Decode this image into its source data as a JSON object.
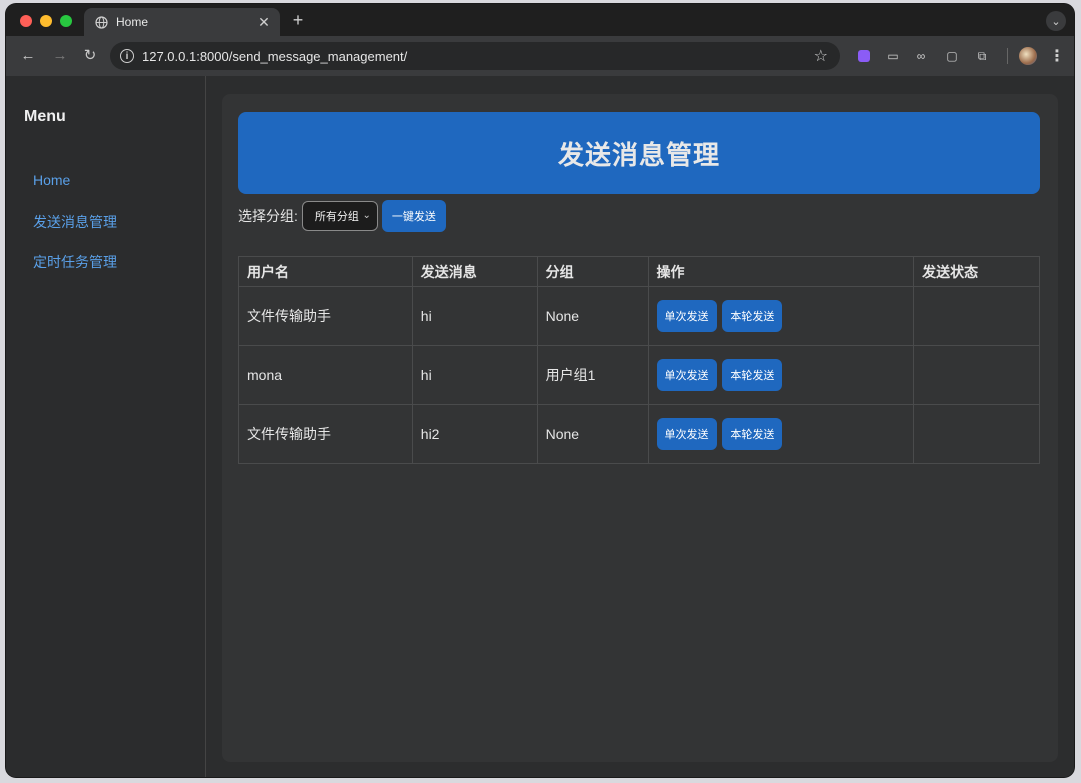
{
  "browser": {
    "tab_title": "Home",
    "url": "127.0.0.1:8000/send_message_management/"
  },
  "sidebar": {
    "title": "Menu",
    "items": [
      {
        "label": "Home"
      },
      {
        "label": "发送消息管理"
      },
      {
        "label": "定时任务管理"
      }
    ]
  },
  "main": {
    "banner_title": "发送消息管理",
    "filter_label": "选择分组:",
    "group_select_value": "所有分组",
    "send_all_label": "一键发送",
    "table": {
      "headers": [
        "用户名",
        "发送消息",
        "分组",
        "操作",
        "发送状态"
      ],
      "rows": [
        {
          "username": "文件传输助手",
          "message": "hi",
          "group": "None",
          "status": ""
        },
        {
          "username": "mona",
          "message": "hi",
          "group": "用户组1",
          "status": ""
        },
        {
          "username": "文件传输助手",
          "message": "hi2",
          "group": "None",
          "status": ""
        }
      ],
      "single_send_label": "单次发送",
      "round_send_label": "本轮发送"
    }
  },
  "colors": {
    "accent": "#1f68bf",
    "link": "#5aa0e8",
    "background": "#2c2d2e"
  }
}
